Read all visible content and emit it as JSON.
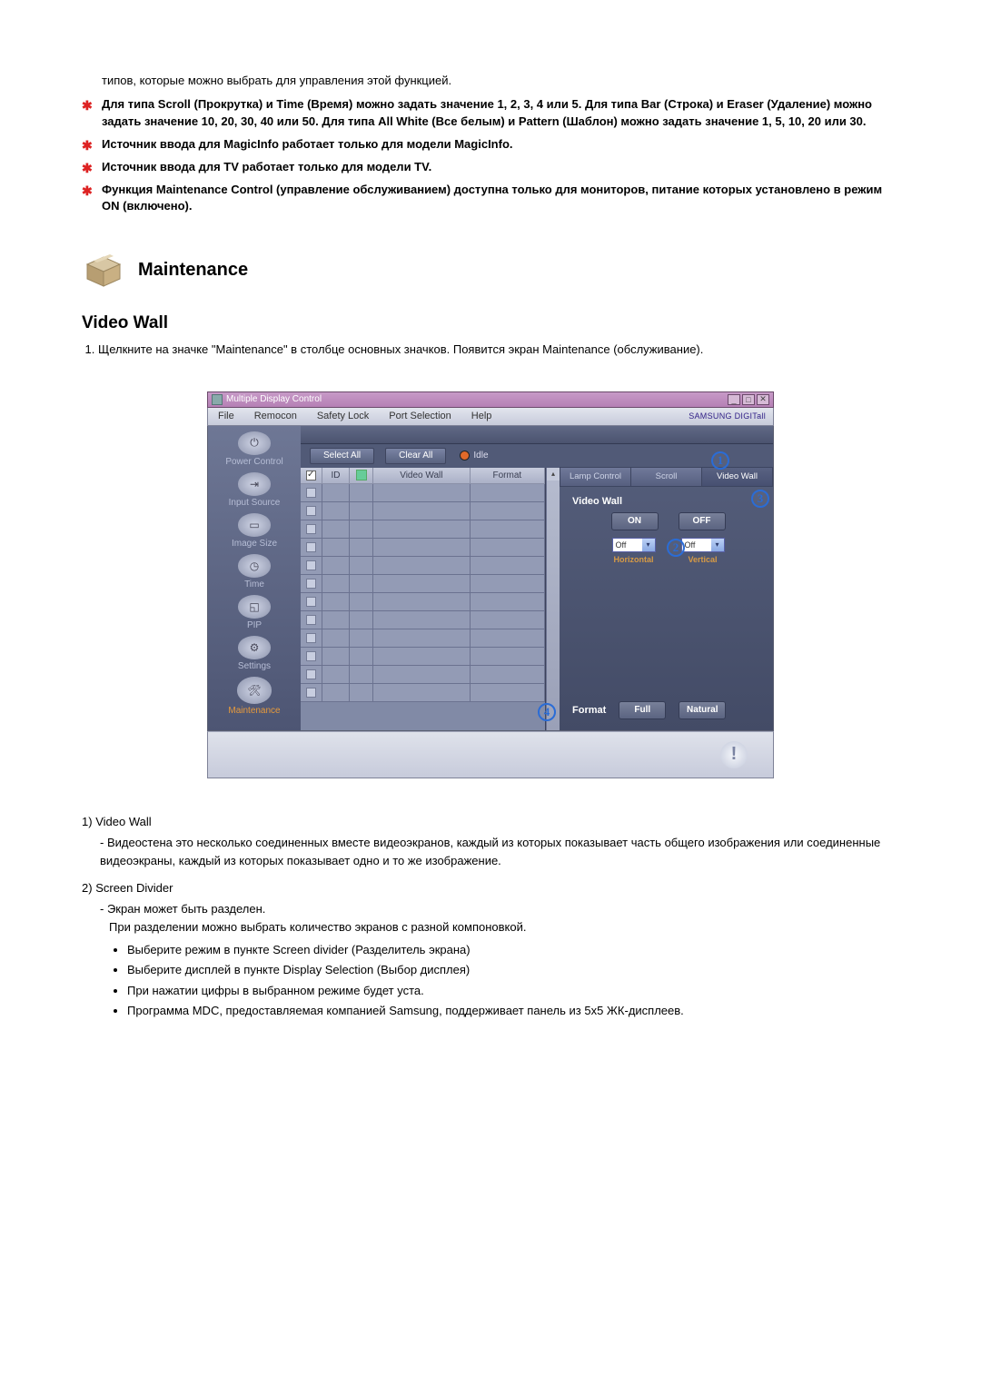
{
  "intro_line": "типов, которые можно выбрать для управления этой функцией.",
  "stars": [
    "Для типа Scroll (Прокрутка) и Time (Время) можно задать значение 1, 2, 3, 4 или 5. Для типа Bar (Строка) и Eraser (Удаление) можно задать значение 10, 20, 30, 40 или 50. Для типа All White (Все белым) и Pattern (Шаблон) можно задать значение 1, 5, 10, 20 или 30.",
    "Источник ввода для MagicInfo работает только для модели MagicInfo.",
    "Источник ввода для TV работает только для модели TV.",
    "Функция Maintenance Control (управление обслуживанием) доступна только для мониторов, питание которых установлено в режим ON (включено)."
  ],
  "section_maintenance": "Maintenance",
  "h_video_wall": "Video Wall",
  "step1": "Щелкните на значке \"Maintenance\" в столбце основных значков. Появится экран Maintenance (обслуживание).",
  "app": {
    "title": "Multiple Display Control",
    "menu": {
      "file": "File",
      "remocon": "Remocon",
      "safety": "Safety Lock",
      "port": "Port Selection",
      "help": "Help"
    },
    "brand": "SAMSUNG DIGITall",
    "sidebar": {
      "power": "Power Control",
      "input": "Input Source",
      "image": "Image Size",
      "time": "Time",
      "pip": "PIP",
      "settings": "Settings",
      "maintenance": "Maintenance"
    },
    "toolbar": {
      "select_all": "Select All",
      "clear_all": "Clear All",
      "idle": "Idle"
    },
    "columns": {
      "id": "ID",
      "videowall": "Video Wall",
      "format": "Format"
    },
    "tabs": {
      "lamp": "Lamp Control",
      "scroll": "Scroll",
      "video": "Video Wall"
    },
    "vw": {
      "title": "Video Wall",
      "on": "ON",
      "off": "OFF",
      "h_opt": "Off",
      "v_opt": "Off",
      "h_lbl": "Horizontal",
      "v_lbl": "Vertical"
    },
    "fmt": {
      "title": "Format",
      "full": "Full",
      "natural": "Natural"
    }
  },
  "callouts": {
    "c1": "1",
    "c2": "2",
    "c3": "3",
    "c4": "4"
  },
  "desc": {
    "d1_num": "1)",
    "d1_title": "Video Wall",
    "d1_text": "- Видеостена это несколько соединенных вместе видеоэкранов, каждый из которых показывает часть общего изображения или соединенные видеоэкраны, каждый из которых показывает одно и то же изображение.",
    "d2_num": "2)",
    "d2_title": "Screen Divider",
    "d2_dash1": "- Экран может быть разделен.",
    "d2_line2": "При разделении можно выбрать количество экранов с разной компоновкой.",
    "b1": "Выберите режим в пункте Screen divider (Разделитель экрана)",
    "b2": "Выберите дисплей в пункте Display Selection (Выбор дисплея)",
    "b3": "При нажатии цифры в выбранном режиме будет уста.",
    "b4": "Программа MDC, предоставляемая компанией Samsung, поддерживает панель из 5x5 ЖК-дисплеев."
  }
}
